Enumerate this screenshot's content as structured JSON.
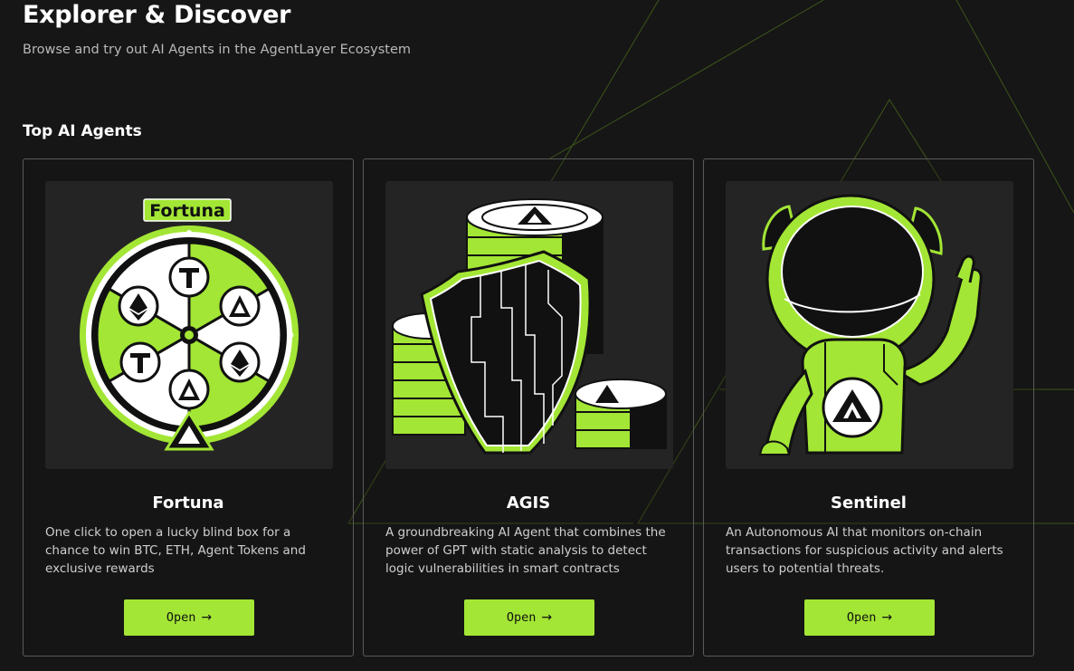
{
  "header": {
    "title": "Explorer & Discover",
    "subtitle": "Browse and try out AI Agents in the AgentLayer Ecosystem"
  },
  "section": {
    "title": "Top AI Agents"
  },
  "agents": [
    {
      "name": "Fortuna",
      "image_label": "Fortuna",
      "description": "One click to open a lucky blind box for a chance to win BTC, ETH, Agent Tokens and exclusive rewards",
      "button_label": "Open",
      "button_icon": "arrow-right-icon"
    },
    {
      "name": "AGIS",
      "description": "A groundbreaking AI Agent that combines the power of GPT with static analysis to detect logic vulnerabilities in smart contracts",
      "button_label": "Open",
      "button_icon": "arrow-right-icon"
    },
    {
      "name": "Sentinel",
      "description": "An Autonomous AI that monitors on-chain transactions for suspicious activity and alerts users to potential threats.",
      "button_label": "Open",
      "button_icon": "arrow-right-icon"
    }
  ],
  "colors": {
    "background": "#161616",
    "accent": "#a3e635",
    "card_border": "#5a5a5a",
    "image_bg": "#242424"
  }
}
